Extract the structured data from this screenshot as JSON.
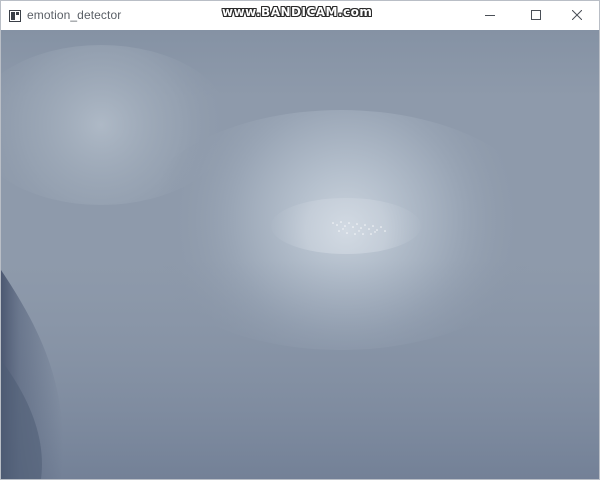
{
  "window": {
    "title": "emotion_detector",
    "watermark": "www.BANDICAM.com"
  },
  "controls": {
    "minimize_icon": "minimize-icon",
    "maximize_icon": "maximize-icon",
    "close_icon": "close-icon"
  },
  "colors": {
    "titlebar_bg": "#ffffff",
    "camera_base": "#8e9aab",
    "camera_highlight": "#c4ced9",
    "camera_shadow": "#4f5c74"
  }
}
